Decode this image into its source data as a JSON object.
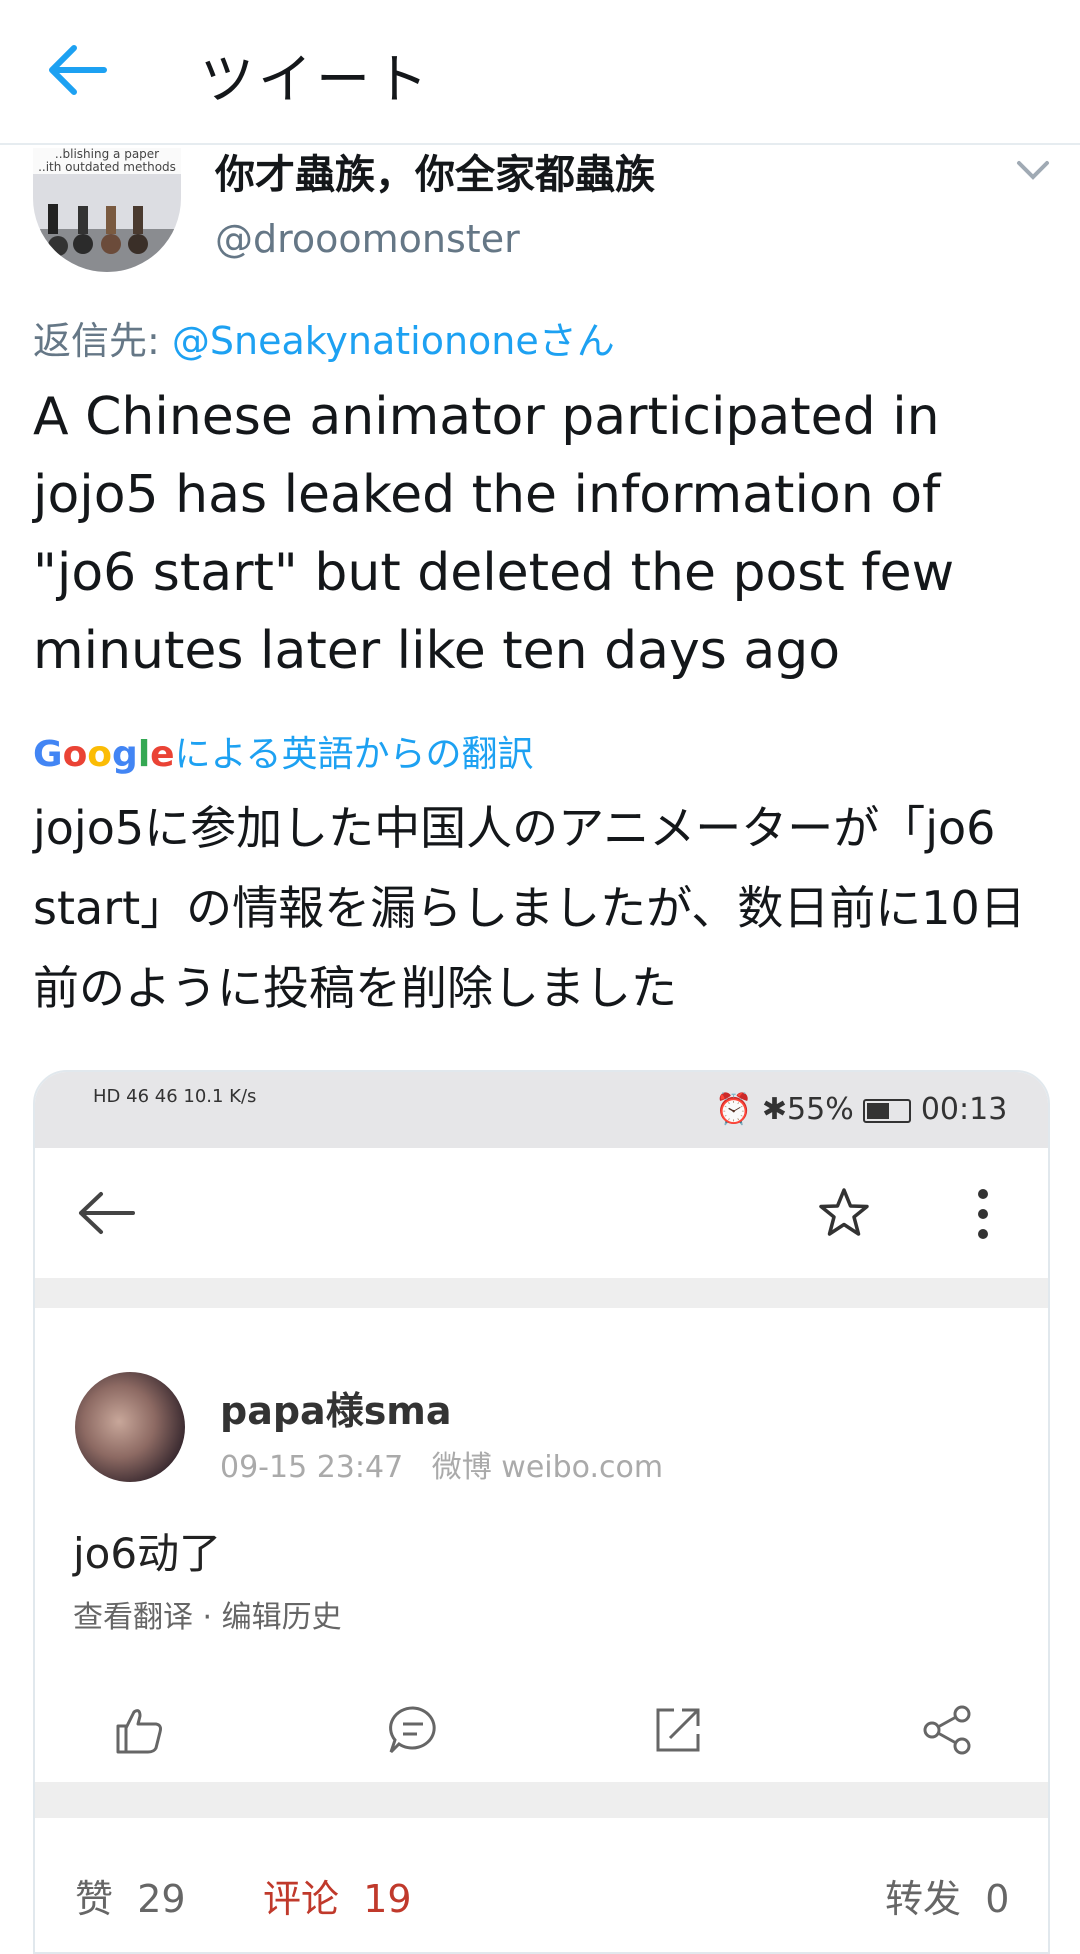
{
  "header": {
    "title": "ツイート"
  },
  "tweet": {
    "avatar_caption": "..blishing a paper\n..ith outdated methods",
    "display_name": "你才蟲族，你全家都蟲族",
    "handle": "@drooomonster",
    "reply_prefix": "返信先: ",
    "reply_mention": "@Sneakynationoneさん",
    "text": "A Chinese animator participated in jojo5 has leaked the information of \"jo6 start\" but deleted the post few minutes later like ten days ago",
    "translation_label": "による英語からの翻訳",
    "google_letters": [
      "G",
      "o",
      "o",
      "g",
      "l",
      "e"
    ],
    "translated_text": "jojo5に参加した中国人のアニメーターが「jo6 start」の情報を漏らしましたが、数日前に10日前のように投稿を削除しました"
  },
  "embedded": {
    "statusbar": {
      "left_text": "HD 46 46 10.1 K/s",
      "battery": "55%",
      "time": "00:13"
    },
    "post": {
      "name": "papa様sma",
      "meta": "09-15 23:47   微博 weibo.com",
      "text": "jo6动了",
      "links": "查看翻译 · 编辑历史"
    },
    "counts": {
      "likes_label": "赞",
      "likes": "29",
      "comments_label": "评论",
      "comments": "19",
      "reposts_label": "转发",
      "reposts": "0"
    }
  },
  "colors": {
    "accent": "#1da1f2",
    "text": "#14171a",
    "muted": "#657786",
    "weibo_red": "#c0392b"
  },
  "icons": [
    "back-arrow-icon",
    "caret-down-icon",
    "star-icon",
    "more-vert-icon",
    "like-icon",
    "comment-icon",
    "share-out-icon",
    "share-icon"
  ]
}
